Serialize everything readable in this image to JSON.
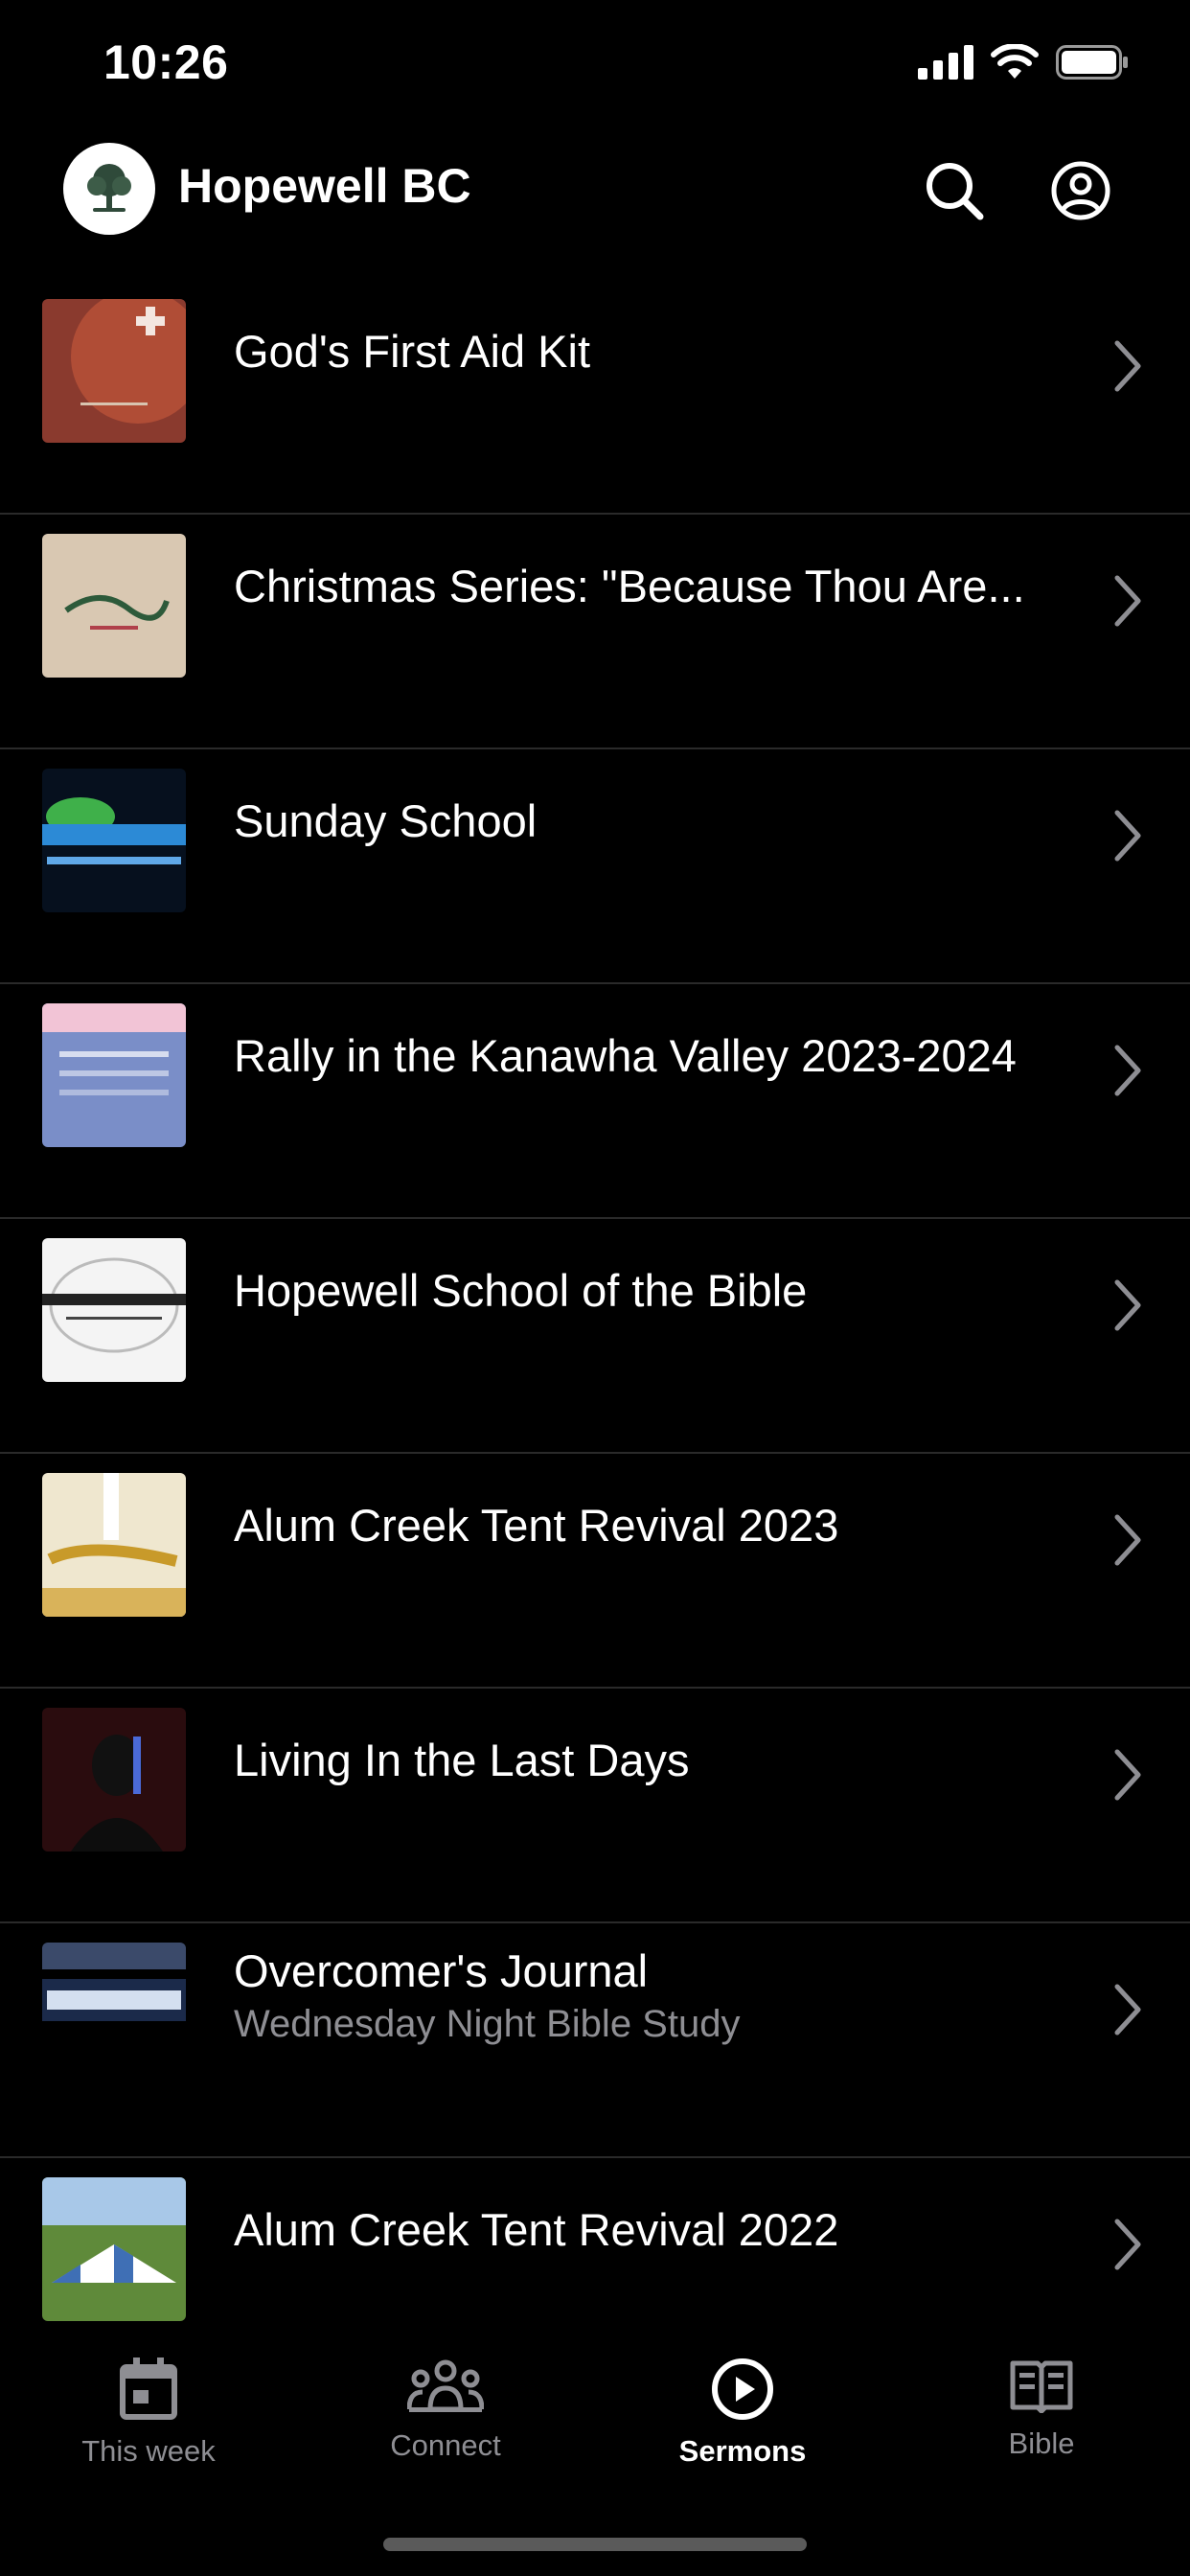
{
  "status_bar": {
    "time": "10:26"
  },
  "header": {
    "title": "Hopewell BC"
  },
  "sermons": [
    {
      "title": "God's First Aid Kit",
      "subtitle": "",
      "thumb": {
        "bg": "#8a3a2e",
        "accent": "#d8c4b0"
      }
    },
    {
      "title": "Christmas Series: \"Because Thou Are...",
      "subtitle": "",
      "thumb": {
        "bg": "#d9c8b2",
        "accent": "#2d5a3a"
      }
    },
    {
      "title": "Sunday School",
      "subtitle": "",
      "thumb": {
        "bg": "#06101e",
        "accent": "#2c8ad6"
      }
    },
    {
      "title": "Rally in the Kanawha Valley 2023-2024",
      "subtitle": "",
      "thumb": {
        "bg": "#7a8ec8",
        "accent": "#f2c4d6"
      }
    },
    {
      "title": "Hopewell School of the Bible",
      "subtitle": "",
      "thumb": {
        "bg": "#f4f4f4",
        "accent": "#222222"
      }
    },
    {
      "title": "Alum Creek Tent Revival 2023",
      "subtitle": "",
      "thumb": {
        "bg": "#efe7cf",
        "accent": "#c89a2a"
      }
    },
    {
      "title": "Living In the Last Days",
      "subtitle": "",
      "thumb": {
        "bg": "#2a0c0e",
        "accent": "#4a6ad8"
      }
    },
    {
      "title": "Overcomer's Journal",
      "subtitle": "Wednesday Night Bible Study",
      "thumb": {
        "bg": "#1b2a4a",
        "accent": "#d4dff0"
      }
    },
    {
      "title": "Alum Creek Tent Revival 2022",
      "subtitle": "",
      "thumb": {
        "bg": "#5f8a3a",
        "accent": "#3f6fb5"
      }
    }
  ],
  "tabs": [
    {
      "label": "This week",
      "icon": "calendar-icon",
      "active": false
    },
    {
      "label": "Connect",
      "icon": "people-icon",
      "active": false
    },
    {
      "label": "Sermons",
      "icon": "play-circle-icon",
      "active": true
    },
    {
      "label": "Bible",
      "icon": "book-icon",
      "active": false
    }
  ],
  "colors": {
    "background": "#000000",
    "divider": "#2a2a2a",
    "inactive_tab": "#8e8e93",
    "active_tab": "#ffffff"
  }
}
